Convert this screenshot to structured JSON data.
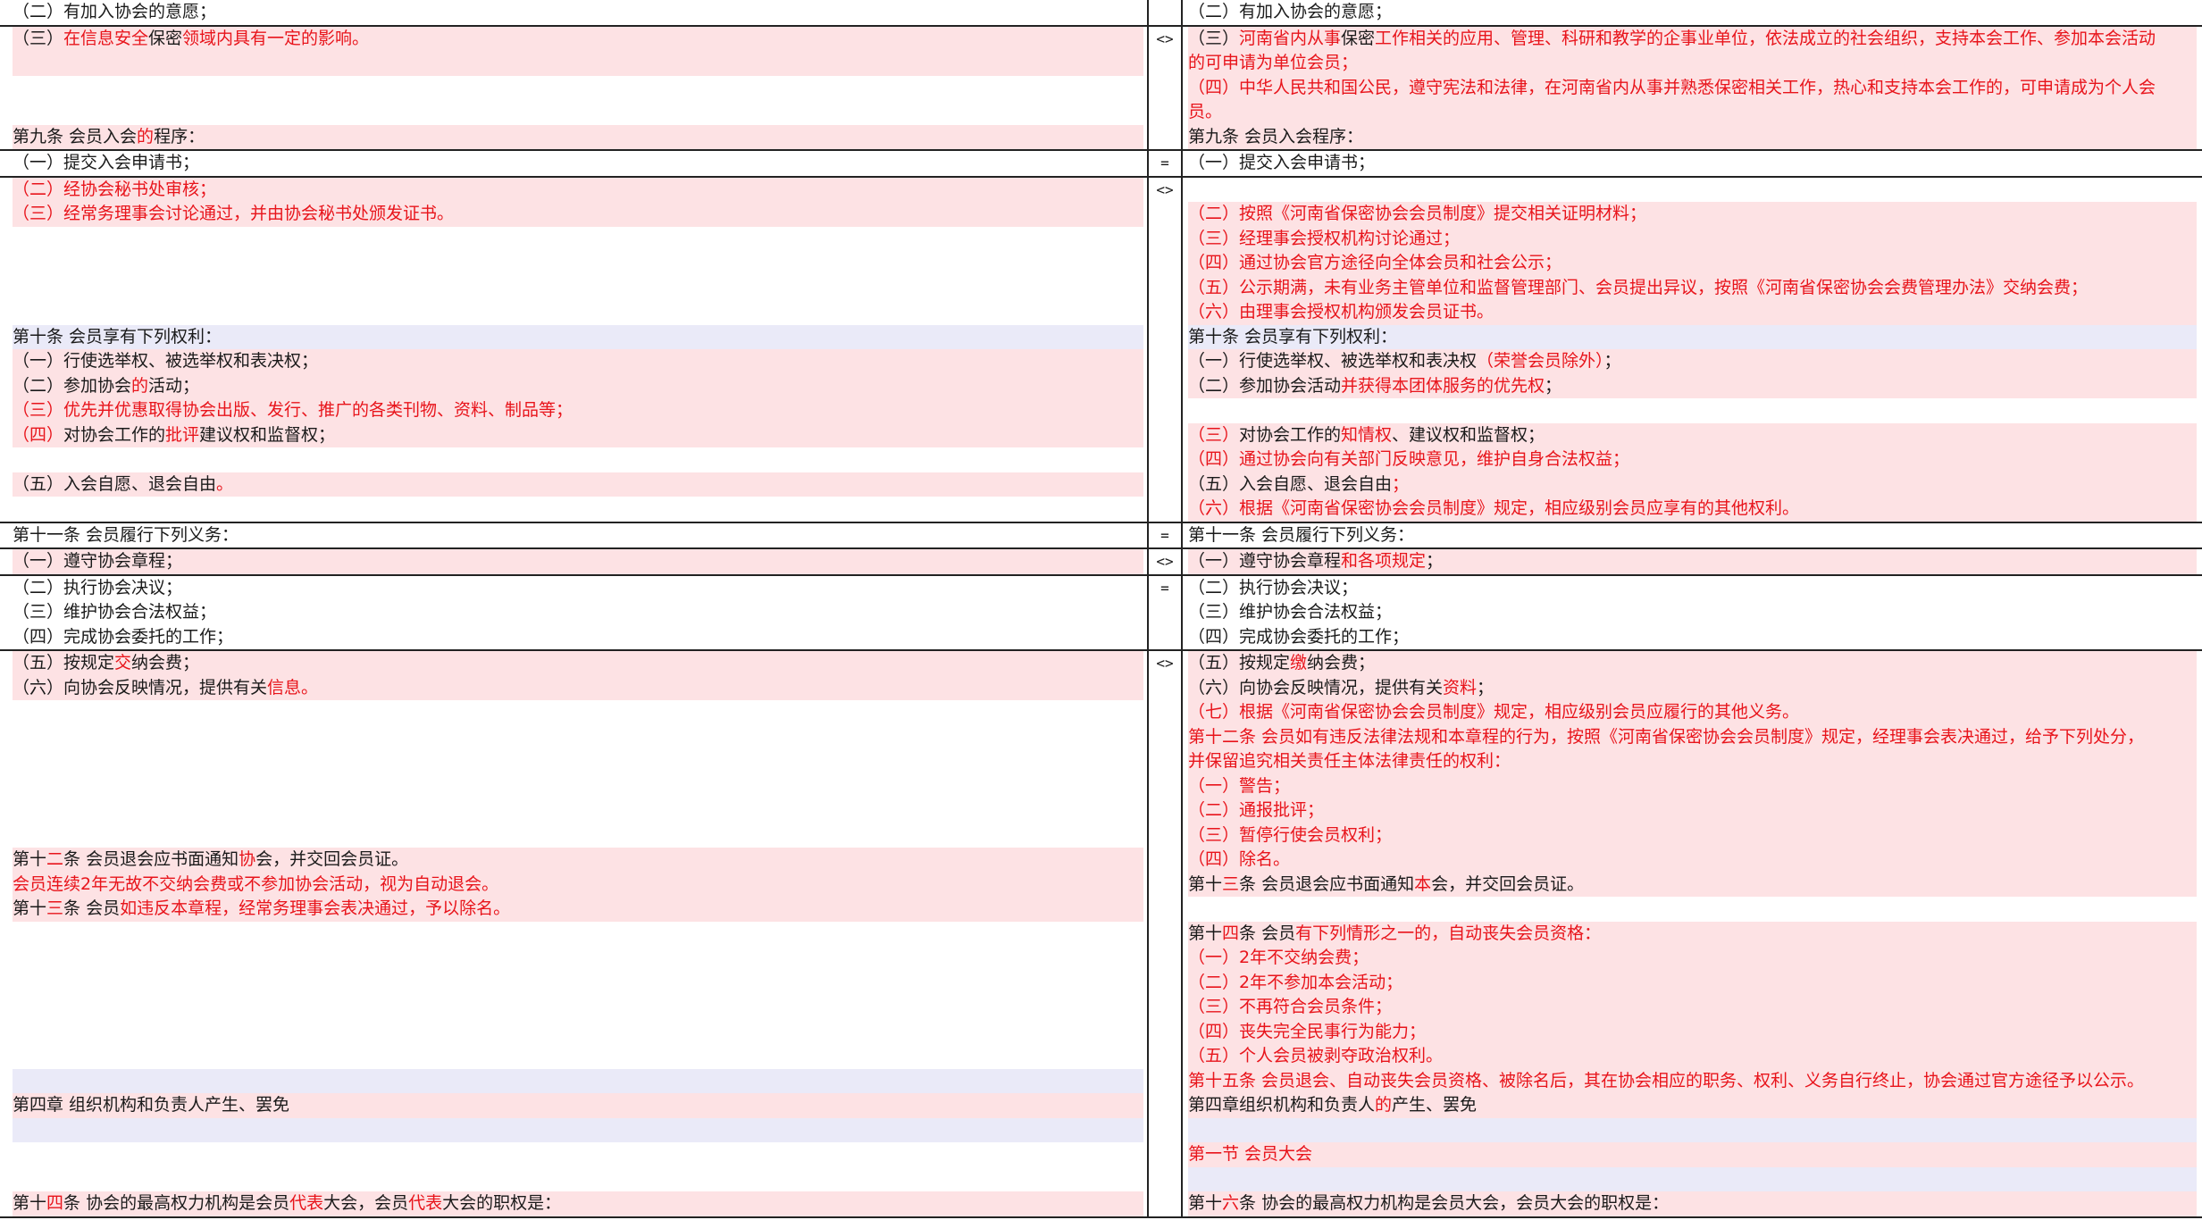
{
  "rows": [
    {
      "marker": "",
      "left": [
        {
          "bg": "none",
          "segs": [
            [
              "（二）有加入协会的意愿；",
              ""
            ]
          ]
        }
      ],
      "right": [
        {
          "bg": "none",
          "segs": [
            [
              "（二）有加入协会的意愿；",
              ""
            ]
          ]
        }
      ]
    },
    {
      "marker": "<>",
      "left": [
        {
          "bg": "pink",
          "segs": [
            [
              "（三）",
              ""
            ],
            [
              "在信息安全",
              "r"
            ],
            [
              "保密",
              ""
            ],
            [
              "领域内具有一定的影响。",
              "r"
            ]
          ]
        },
        {
          "bg": "pink",
          "segs": [
            [
              "",
              ""
            ]
          ]
        },
        {
          "bg": "none",
          "segs": [
            [
              "",
              ""
            ]
          ]
        },
        {
          "bg": "none",
          "segs": [
            [
              "",
              ""
            ]
          ]
        },
        {
          "bg": "pink",
          "segs": [
            [
              "第九条  会员入会",
              ""
            ],
            [
              "的",
              "r"
            ],
            [
              "程序：",
              ""
            ]
          ]
        }
      ],
      "right": [
        {
          "bg": "pink",
          "segs": [
            [
              "（三）",
              ""
            ],
            [
              "河南省内从事",
              "r"
            ],
            [
              "保密",
              ""
            ],
            [
              "工作相关的应用、管理、科研和教学的企事业单位，依法成立的社会组织，支持本会工作、参加本会活动",
              "r"
            ]
          ]
        },
        {
          "bg": "pink",
          "segs": [
            [
              "的可申请为单位会员；",
              "r"
            ]
          ]
        },
        {
          "bg": "pink",
          "segs": [
            [
              "（四）中华人民共和国公民，遵守宪法和法律，在河南省内从事并熟悉保密相关工作，热心和支持本会工作的，可申请成为个人会",
              "r"
            ]
          ]
        },
        {
          "bg": "pink",
          "segs": [
            [
              "员。",
              "r"
            ]
          ]
        },
        {
          "bg": "pink",
          "segs": [
            [
              "第九条  会员入会程序：",
              ""
            ]
          ]
        }
      ]
    },
    {
      "marker": "=",
      "left": [
        {
          "bg": "none",
          "segs": [
            [
              "（一）提交入会申请书；",
              ""
            ]
          ]
        }
      ],
      "right": [
        {
          "bg": "none",
          "segs": [
            [
              "（一）提交入会申请书；",
              ""
            ]
          ]
        }
      ]
    },
    {
      "marker": "<>",
      "left": [
        {
          "bg": "pink",
          "segs": [
            [
              "（二）经协会秘书处审核；",
              "r"
            ]
          ]
        },
        {
          "bg": "pink",
          "segs": [
            [
              "（三）经常务理事会讨论通过，并由协会秘书处颁发证书。",
              "r"
            ]
          ]
        },
        {
          "bg": "none",
          "segs": [
            [
              "",
              ""
            ]
          ]
        },
        {
          "bg": "none",
          "segs": [
            [
              "",
              ""
            ]
          ]
        },
        {
          "bg": "none",
          "segs": [
            [
              "",
              ""
            ]
          ]
        },
        {
          "bg": "none",
          "segs": [
            [
              "",
              ""
            ]
          ]
        },
        {
          "bg": "blue",
          "segs": [
            [
              "第十条  会员享有下列权利：",
              ""
            ]
          ]
        },
        {
          "bg": "pink",
          "segs": [
            [
              "（一）行使选举权、被选举权和表决权；",
              ""
            ]
          ]
        },
        {
          "bg": "pink",
          "segs": [
            [
              "（二）参加协会",
              ""
            ],
            [
              "的",
              "r"
            ],
            [
              "活动；",
              ""
            ]
          ]
        },
        {
          "bg": "pink",
          "segs": [
            [
              "（三）优先并优惠取得协会出版、发行、推广的各类刊物、资料、制品等；",
              "r"
            ]
          ]
        },
        {
          "bg": "pink",
          "segs": [
            [
              "（四）",
              "r"
            ],
            [
              "对协会工作的",
              ""
            ],
            [
              "批评",
              "r"
            ],
            [
              "建议权和监督权；",
              ""
            ]
          ]
        },
        {
          "bg": "none",
          "segs": [
            [
              "",
              ""
            ]
          ]
        },
        {
          "bg": "pink",
          "segs": [
            [
              "（五）入会自愿、退会自由",
              ""
            ],
            [
              "。",
              "r"
            ]
          ]
        },
        {
          "bg": "none",
          "segs": [
            [
              "",
              ""
            ]
          ]
        }
      ],
      "right": [
        {
          "bg": "none",
          "segs": [
            [
              "",
              ""
            ]
          ]
        },
        {
          "bg": "pink",
          "segs": [
            [
              "（二）按照《河南省保密协会会员制度》提交相关证明材料；",
              "r"
            ]
          ]
        },
        {
          "bg": "pink",
          "segs": [
            [
              "（三）经理事会授权机构讨论通过；",
              "r"
            ]
          ]
        },
        {
          "bg": "pink",
          "segs": [
            [
              "（四）通过协会官方途径向全体会员和社会公示；",
              "r"
            ]
          ]
        },
        {
          "bg": "pink",
          "segs": [
            [
              "（五）公示期满，未有业务主管单位和监督管理部门、会员提出异议，按照《河南省保密协会会费管理办法》交纳会费；",
              "r"
            ]
          ]
        },
        {
          "bg": "pink",
          "segs": [
            [
              "（六）由理事会授权机构颁发会员证书。",
              "r"
            ]
          ]
        },
        {
          "bg": "blue",
          "segs": [
            [
              "第十条      会员享有下列权利：",
              ""
            ]
          ]
        },
        {
          "bg": "pink",
          "segs": [
            [
              "（一）行使选举权、被选举权和表决权",
              ""
            ],
            [
              "（荣誉会员除外）",
              "r"
            ],
            [
              "；",
              ""
            ]
          ]
        },
        {
          "bg": "pink",
          "segs": [
            [
              "（二）参加协会活动",
              ""
            ],
            [
              "并获得本团体服务的优先权",
              "r"
            ],
            [
              "；",
              ""
            ]
          ]
        },
        {
          "bg": "none",
          "segs": [
            [
              "",
              ""
            ]
          ]
        },
        {
          "bg": "pink",
          "segs": [
            [
              "（三）",
              "r"
            ],
            [
              "对协会工作的",
              ""
            ],
            [
              "知情权",
              "r"
            ],
            [
              "、建议权和监督权；",
              ""
            ]
          ]
        },
        {
          "bg": "pink",
          "segs": [
            [
              "（四）通过协会向有关部门反映意见，维护自身合法权益；",
              "r"
            ]
          ]
        },
        {
          "bg": "pink",
          "segs": [
            [
              "（五）入会自愿、退会自由",
              ""
            ],
            [
              "；",
              "r"
            ]
          ]
        },
        {
          "bg": "pink",
          "segs": [
            [
              "（六）根据《河南省保密协会会员制度》规定，相应级别会员应享有的其他权利。",
              "r"
            ]
          ]
        }
      ]
    },
    {
      "marker": "=",
      "left": [
        {
          "bg": "none",
          "segs": [
            [
              "第十一条  会员履行下列义务：",
              ""
            ]
          ]
        }
      ],
      "right": [
        {
          "bg": "none",
          "segs": [
            [
              "第十一条  会员履行下列义务：",
              ""
            ]
          ]
        }
      ]
    },
    {
      "marker": "<>",
      "left": [
        {
          "bg": "pink",
          "segs": [
            [
              "（一）遵守协会章程；",
              ""
            ]
          ]
        }
      ],
      "right": [
        {
          "bg": "pink",
          "segs": [
            [
              "（一）遵守协会章程",
              ""
            ],
            [
              "和各项规定",
              "r"
            ],
            [
              "；",
              ""
            ]
          ]
        }
      ]
    },
    {
      "marker": "=",
      "left": [
        {
          "bg": "none",
          "segs": [
            [
              "（二）执行协会决议；",
              ""
            ]
          ]
        },
        {
          "bg": "none",
          "segs": [
            [
              "（三）维护协会合法权益；",
              ""
            ]
          ]
        },
        {
          "bg": "none",
          "segs": [
            [
              "（四）完成协会委托的工作；",
              ""
            ]
          ]
        }
      ],
      "right": [
        {
          "bg": "none",
          "segs": [
            [
              "（二）执行协会决议；",
              ""
            ]
          ]
        },
        {
          "bg": "none",
          "segs": [
            [
              "（三）维护协会合法权益；",
              ""
            ]
          ]
        },
        {
          "bg": "none",
          "segs": [
            [
              "（四）完成协会委托的工作；",
              ""
            ]
          ]
        }
      ]
    },
    {
      "marker": "<>",
      "left": [
        {
          "bg": "pink",
          "segs": [
            [
              "（五）按规定",
              ""
            ],
            [
              "交",
              "r"
            ],
            [
              "纳会费；",
              ""
            ]
          ]
        },
        {
          "bg": "pink",
          "segs": [
            [
              "（六）向协会反映情况，提供有关",
              ""
            ],
            [
              "信息。",
              "r"
            ]
          ]
        },
        {
          "bg": "none",
          "segs": [
            [
              "",
              ""
            ]
          ]
        },
        {
          "bg": "none",
          "segs": [
            [
              "",
              ""
            ]
          ]
        },
        {
          "bg": "none",
          "segs": [
            [
              "",
              ""
            ]
          ]
        },
        {
          "bg": "none",
          "segs": [
            [
              "",
              ""
            ]
          ]
        },
        {
          "bg": "none",
          "segs": [
            [
              "",
              ""
            ]
          ]
        },
        {
          "bg": "none",
          "segs": [
            [
              "",
              ""
            ]
          ]
        },
        {
          "bg": "pink",
          "segs": [
            [
              "第十",
              ""
            ],
            [
              "二",
              "r"
            ],
            [
              "条  会员退会应书面通知",
              ""
            ],
            [
              "协",
              "r"
            ],
            [
              "会，并交回会员证。",
              ""
            ]
          ]
        },
        {
          "bg": "pink",
          "segs": [
            [
              "会员连续2年无故不交纳会费或不参加协会活动，视为自动退会。",
              "r"
            ]
          ]
        },
        {
          "bg": "pink",
          "segs": [
            [
              "第十",
              ""
            ],
            [
              "三",
              "r"
            ],
            [
              "条  会员",
              ""
            ],
            [
              "如违反本章程，经常务理事会表决通过，予以除名。",
              "r"
            ]
          ]
        },
        {
          "bg": "none",
          "segs": [
            [
              "",
              ""
            ]
          ]
        },
        {
          "bg": "none",
          "segs": [
            [
              "",
              ""
            ]
          ]
        },
        {
          "bg": "none",
          "segs": [
            [
              "",
              ""
            ]
          ]
        },
        {
          "bg": "none",
          "segs": [
            [
              "",
              ""
            ]
          ]
        },
        {
          "bg": "none",
          "segs": [
            [
              "",
              ""
            ]
          ]
        },
        {
          "bg": "none",
          "segs": [
            [
              "",
              ""
            ]
          ]
        },
        {
          "bg": "blue",
          "segs": [
            [
              "",
              ""
            ]
          ]
        },
        {
          "bg": "pink",
          "segs": [
            [
              "第四章  组织机构和负责人产生、罢免",
              ""
            ]
          ]
        },
        {
          "bg": "blue",
          "segs": [
            [
              "",
              ""
            ]
          ]
        },
        {
          "bg": "none",
          "segs": [
            [
              "",
              ""
            ]
          ]
        },
        {
          "bg": "none",
          "segs": [
            [
              "",
              ""
            ]
          ]
        },
        {
          "bg": "pink",
          "segs": [
            [
              "第十",
              ""
            ],
            [
              "四",
              "r"
            ],
            [
              "条  协会的最高权力机构是会员",
              ""
            ],
            [
              "代表",
              "r"
            ],
            [
              "大会，会员",
              ""
            ],
            [
              "代表",
              "r"
            ],
            [
              "大会的职权是：",
              ""
            ]
          ]
        }
      ],
      "right": [
        {
          "bg": "pink",
          "segs": [
            [
              "（五）按规定",
              ""
            ],
            [
              "缴",
              "r"
            ],
            [
              "纳会费；",
              ""
            ]
          ]
        },
        {
          "bg": "pink",
          "segs": [
            [
              "（六）向协会反映情况，提供有关",
              ""
            ],
            [
              "资料",
              "r"
            ],
            [
              "；",
              ""
            ]
          ]
        },
        {
          "bg": "pink",
          "segs": [
            [
              "（七）根据《河南省保密协会会员制度》规定，相应级别会员应履行的其他义务。",
              "r"
            ]
          ]
        },
        {
          "bg": "pink",
          "segs": [
            [
              "第十二条  会员如有违反法律法规和本章程的行为，按照《河南省保密协会会员制度》规定，经理事会表决通过，给予下列处分，",
              "r"
            ]
          ]
        },
        {
          "bg": "pink",
          "segs": [
            [
              "并保留追究相关责任主体法律责任的权利：",
              "r"
            ]
          ]
        },
        {
          "bg": "pink",
          "segs": [
            [
              "（一）警告；",
              "r"
            ]
          ]
        },
        {
          "bg": "pink",
          "segs": [
            [
              "（二）通报批评；",
              "r"
            ]
          ]
        },
        {
          "bg": "pink",
          "segs": [
            [
              "（三）暂停行使会员权利；",
              "r"
            ]
          ]
        },
        {
          "bg": "pink",
          "segs": [
            [
              "（四）除名。",
              "r"
            ]
          ]
        },
        {
          "bg": "pink",
          "segs": [
            [
              "第十",
              ""
            ],
            [
              "三",
              "r"
            ],
            [
              "条  会员退会应书面通知",
              ""
            ],
            [
              "本",
              "r"
            ],
            [
              "会，并交回会员证。",
              ""
            ]
          ]
        },
        {
          "bg": "none",
          "segs": [
            [
              "",
              ""
            ]
          ]
        },
        {
          "bg": "pink",
          "segs": [
            [
              "第十",
              ""
            ],
            [
              "四",
              "r"
            ],
            [
              "条  会员",
              ""
            ],
            [
              "有下列情形之一的，自动丧失会员资格：",
              "r"
            ]
          ]
        },
        {
          "bg": "pink",
          "segs": [
            [
              "（一）2年不交纳会费；",
              "r"
            ]
          ]
        },
        {
          "bg": "pink",
          "segs": [
            [
              "（二）2年不参加本会活动；",
              "r"
            ]
          ]
        },
        {
          "bg": "pink",
          "segs": [
            [
              "（三）不再符合会员条件；",
              "r"
            ]
          ]
        },
        {
          "bg": "pink",
          "segs": [
            [
              "（四）丧失完全民事行为能力；",
              "r"
            ]
          ]
        },
        {
          "bg": "pink",
          "segs": [
            [
              "（五）个人会员被剥夺政治权利。",
              "r"
            ]
          ]
        },
        {
          "bg": "pink",
          "segs": [
            [
              "第十五条  会员退会、自动丧失会员资格、被除名后，其在协会相应的职务、权利、义务自行终止，协会通过官方途径予以公示。",
              "r"
            ]
          ]
        },
        {
          "bg": "pink",
          "segs": [
            [
              "第四章组织机构和负责人",
              ""
            ],
            [
              "的",
              "r"
            ],
            [
              "产生、罢免",
              ""
            ]
          ]
        },
        {
          "bg": "blue",
          "segs": [
            [
              "",
              ""
            ]
          ]
        },
        {
          "bg": "pink",
          "segs": [
            [
              "第一节  会员大会",
              "r"
            ]
          ]
        },
        {
          "bg": "blue",
          "segs": [
            [
              "",
              ""
            ]
          ]
        },
        {
          "bg": "pink",
          "segs": [
            [
              "第十",
              ""
            ],
            [
              "六",
              "r"
            ],
            [
              "条  协会的最高权力机构是会员大会，会员大会的职权是：",
              ""
            ]
          ]
        }
      ]
    }
  ]
}
